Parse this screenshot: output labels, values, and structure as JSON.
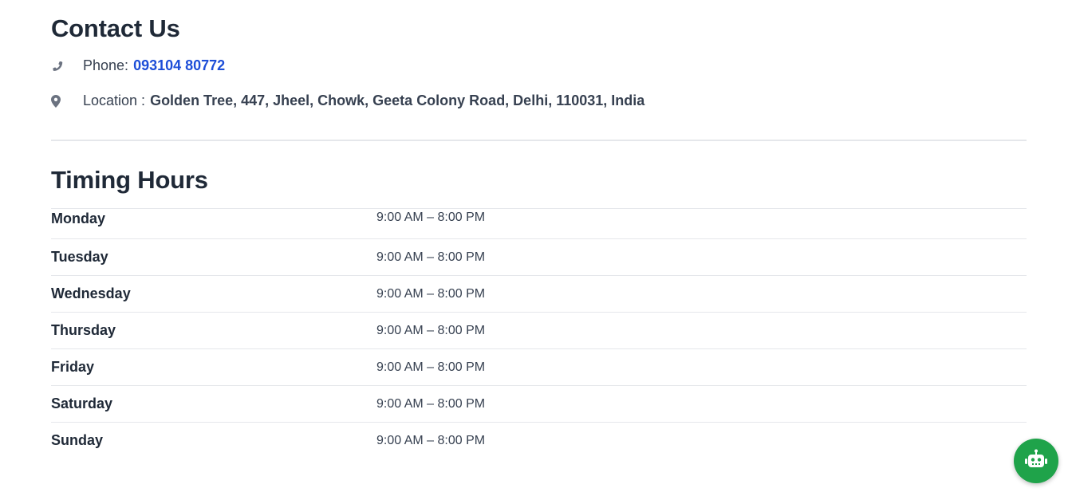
{
  "contact": {
    "title": "Contact Us",
    "phone_label": "Phone:",
    "phone_number": "093104 80772",
    "location_label": "Location :",
    "location_value": "Golden Tree, 447, Jheel, Chowk, Geeta Colony Road, Delhi, 110031, India",
    "icons": [
      "phone-icon",
      "map-pin-icon"
    ]
  },
  "timing": {
    "title": "Timing Hours",
    "rows": [
      {
        "day": "Monday",
        "hours": "9:00 AM – 8:00 PM"
      },
      {
        "day": "Tuesday",
        "hours": "9:00 AM – 8:00 PM"
      },
      {
        "day": "Wednesday",
        "hours": "9:00 AM – 8:00 PM"
      },
      {
        "day": "Thursday",
        "hours": "9:00 AM – 8:00 PM"
      },
      {
        "day": "Friday",
        "hours": "9:00 AM – 8:00 PM"
      },
      {
        "day": "Saturday",
        "hours": "9:00 AM – 8:00 PM"
      },
      {
        "day": "Sunday",
        "hours": "9:00 AM – 8:00 PM"
      }
    ]
  },
  "chat_widget": {
    "icon": "robot-icon",
    "color": "#1fa34a"
  },
  "colors": {
    "link": "#1d4ed8",
    "text": "#1f2937",
    "divider": "#e5e7eb"
  }
}
